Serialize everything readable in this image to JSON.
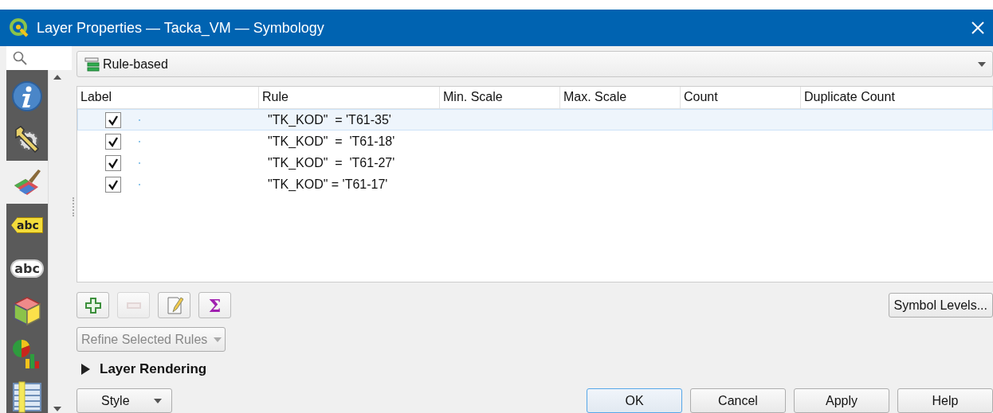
{
  "window": {
    "title": "Layer Properties — Tacka_VM — Symbology"
  },
  "sidebar": {
    "items": [
      {
        "kind": "info",
        "selected": false
      },
      {
        "kind": "settings",
        "selected": false
      },
      {
        "kind": "symbology",
        "selected": true
      },
      {
        "kind": "tag",
        "text": "abc",
        "selected": false
      },
      {
        "kind": "bubble",
        "text": "abc",
        "selected": false
      },
      {
        "kind": "cube",
        "selected": false
      },
      {
        "kind": "diagram",
        "selected": false
      },
      {
        "kind": "fields",
        "selected": false
      }
    ]
  },
  "renderer": {
    "value": "Rule-based"
  },
  "table": {
    "columns": [
      "Label",
      "Rule",
      "Min. Scale",
      "Max. Scale",
      "Count",
      "Duplicate Count"
    ],
    "rows": [
      {
        "checked": true,
        "selected": true,
        "rule": "\"TK_KOD\"  = 'T61-35'"
      },
      {
        "checked": true,
        "selected": false,
        "rule": "\"TK_KOD\"  =  'T61-18'"
      },
      {
        "checked": true,
        "selected": false,
        "rule": "\"TK_KOD\"  =  'T61-27'"
      },
      {
        "checked": true,
        "selected": false,
        "rule": "\"TK_KOD\" = 'T61-17'"
      }
    ]
  },
  "rule_tools": [
    {
      "kind": "add",
      "disabled": false
    },
    {
      "kind": "remove",
      "disabled": true
    },
    {
      "kind": "edit",
      "disabled": false
    },
    {
      "kind": "sum",
      "text": "Σ",
      "disabled": false
    }
  ],
  "symbol_levels_button": "Symbol Levels...",
  "refine_dropdown": {
    "label": "Refine Selected Rules",
    "disabled": true
  },
  "layer_rendering": {
    "label": "Layer Rendering",
    "expanded": false
  },
  "style_button": "Style",
  "buttons": [
    {
      "label": "OK",
      "default": true
    },
    {
      "label": "Cancel",
      "default": false
    },
    {
      "label": "Apply",
      "default": false
    },
    {
      "label": "Help",
      "default": false
    }
  ]
}
